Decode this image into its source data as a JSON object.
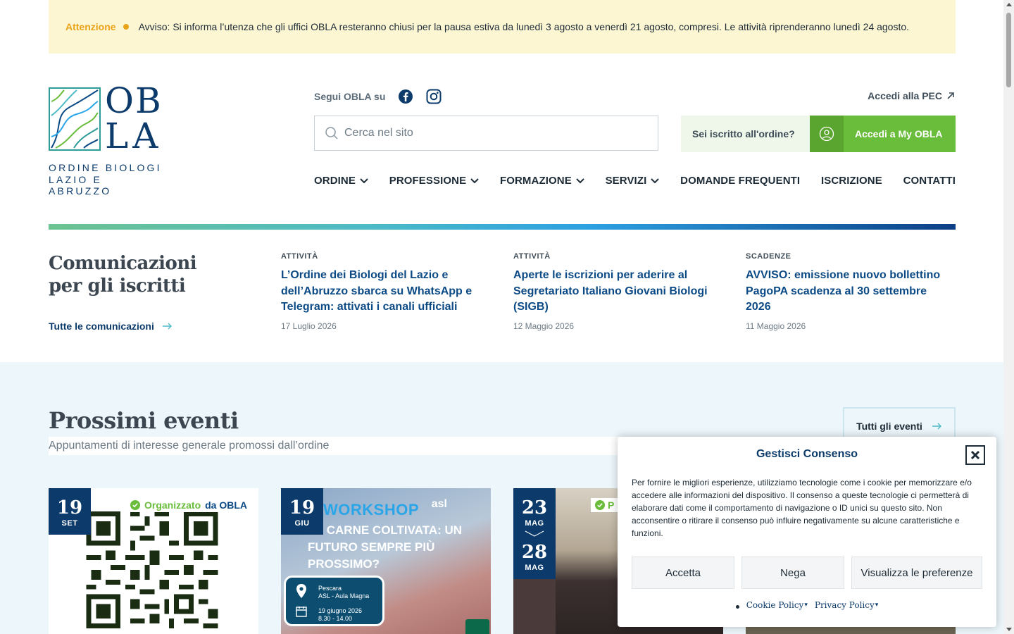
{
  "notice": {
    "label": "Attenzione",
    "text": "Avviso: Si informa l’utenza che gli uffici OBLA resteranno chiusi per la pausa estiva da lunedì 3 agosto a venerdì 21 agosto, compresi. Le attività riprenderanno lunedì 24 agosto."
  },
  "logo": {
    "line1": "OB",
    "line2": "LA",
    "sub1": "ORDINE BIOLOGI",
    "sub2": "LAZIO E ABRUZZO"
  },
  "social": {
    "label": "Segui OBLA su",
    "icons": [
      "facebook-icon",
      "instagram-icon"
    ]
  },
  "pec": {
    "label": "Accedi alla PEC"
  },
  "search": {
    "placeholder": "Cerca nel sito"
  },
  "member": {
    "question": "Sei iscritto all'ordine?",
    "button": "Accedi a My OBLA"
  },
  "nav": {
    "items": [
      {
        "label": "ORDINE",
        "dropdown": true
      },
      {
        "label": "PROFESSIONE",
        "dropdown": true
      },
      {
        "label": "FORMAZIONE",
        "dropdown": true
      },
      {
        "label": "SERVIZI",
        "dropdown": true
      },
      {
        "label": "DOMANDE FREQUENTI",
        "dropdown": false
      },
      {
        "label": "ISCRIZIONE",
        "dropdown": false
      },
      {
        "label": "CONTATTI",
        "dropdown": false
      }
    ]
  },
  "communications": {
    "title_line1": "Comunicazioni",
    "title_line2": "per gli iscritti",
    "all_link": "Tutte le comunicazioni",
    "items": [
      {
        "category": "ATTIVITÀ",
        "headline": "L’Ordine dei Biologi del Lazio e dell’Abruzzo sbarca su WhatsApp e Telegram: attivati i canali ufficiali",
        "date": "17 Luglio 2026"
      },
      {
        "category": "ATTIVITÀ",
        "headline": "Aperte le iscrizioni per aderire al Segretariato Italiano Giovani Biologi (SIGB)",
        "date": "12 Maggio 2026"
      },
      {
        "category": "SCADENZE",
        "headline": "AVVISO: emissione nuovo bollettino PagoPA scadenza al 30 settembre 2026",
        "date": "11 Maggio 2026"
      }
    ]
  },
  "events": {
    "title": "Prossimi eventi",
    "subtitle": "Appuntamenti di interesse generale promossi dall’ordine",
    "all_link": "Tutti gli eventi",
    "badge_organized": "Organizzato",
    "badge_by": "da OBLA",
    "badge_short": "P",
    "cards": [
      {
        "day": "19",
        "month": "SET"
      },
      {
        "day": "19",
        "month": "GIU",
        "workshop_title": "WORKSHOP",
        "workshop_org": "asl",
        "workshop_lines": "LA CARNE COLTIVATA: UN FUTURO SEMPRE PIÙ PROSSIMO?",
        "place1": "Pescara",
        "place2": "ASL - Aula Magna",
        "when1": "19 giugno 2026",
        "when2": "8.30 - 14.00"
      },
      {
        "day": "23",
        "month": "MAG",
        "day_end": "28",
        "month_end": "MAG"
      }
    ]
  },
  "cookie": {
    "title": "Gestisci Consenso",
    "text": "Per fornire le migliori esperienze, utilizziamo tecnologie come i cookie per memorizzare e/o accedere alle informazioni del dispositivo. Il consenso a queste tecnologie ci permetterà di elaborare dati come il comportamento di navigazione o ID unici su questo sito. Non acconsentire o ritirare il consenso può influire negativamente su alcune caratteristiche e funzioni.",
    "accept": "Accetta",
    "deny": "Nega",
    "preferences": "Visualizza le preferenze",
    "cookie_policy": "Cookie Policy",
    "privacy_policy": "Privacy Policy"
  },
  "colors": {
    "brand_navy": "#0c3b6b",
    "brand_green": "#69bd3a",
    "notice_bg": "#fdf6d3",
    "notice_accent": "#e8a317"
  }
}
